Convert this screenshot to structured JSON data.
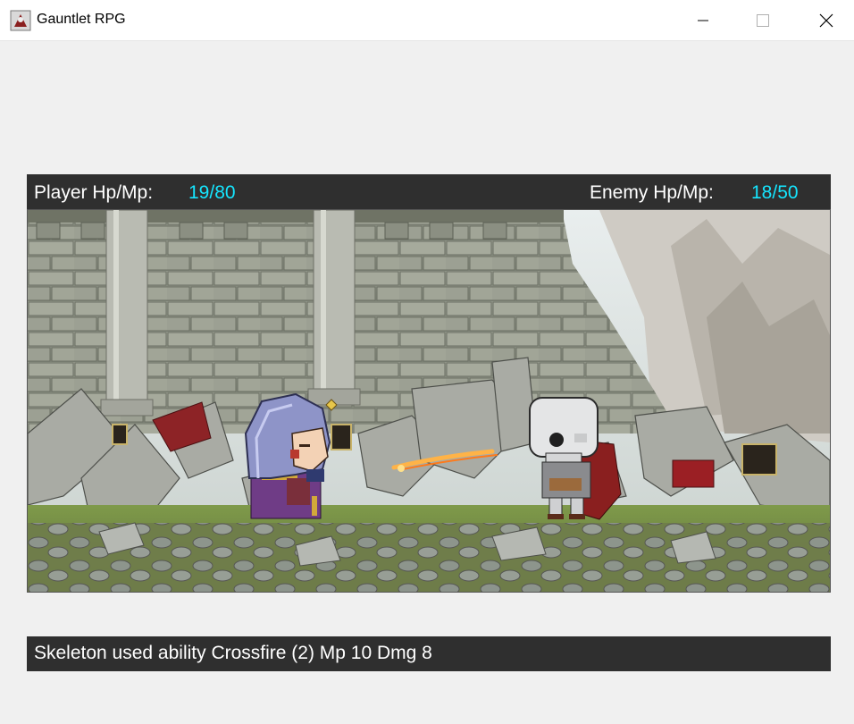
{
  "window": {
    "title": "Gauntlet RPG"
  },
  "stats": {
    "player_label": "Player Hp/Mp:",
    "player_value": "19/80",
    "enemy_label": "Enemy Hp/Mp:",
    "enemy_value": "18/50",
    "value_color": "#15e6ff"
  },
  "battle": {
    "player_sprite": "mage-sprite",
    "enemy_sprite": "skeleton-sprite",
    "effect": "crossfire-projectile"
  },
  "log": {
    "message": "Skeleton used ability Crossfire (2) Mp 10 Dmg 8"
  }
}
